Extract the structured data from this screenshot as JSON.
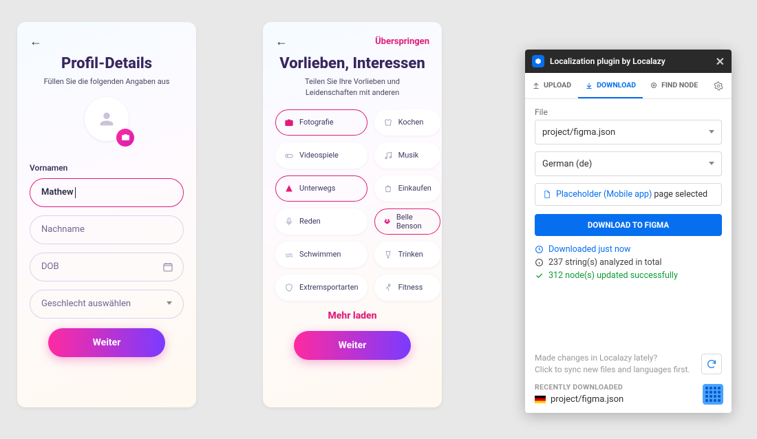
{
  "phone1": {
    "title": "Profil-Details",
    "subtitle": "Füllen Sie die folgenden Angaben aus",
    "firstNameLabel": "Vornamen",
    "firstNameValue": "Mathew",
    "lastNamePlaceholder": "Nachname",
    "dobPlaceholder": "DOB",
    "genderPlaceholder": "Geschlecht auswählen",
    "cta": "Weiter"
  },
  "phone2": {
    "skip": "Überspringen",
    "title": "Vorlieben, Interessen",
    "subtitle": "Teilen Sie Ihre Vorlieben und Leidenschaften mit anderen",
    "chips": [
      {
        "label": "Fotografie",
        "selected": true,
        "icon": "camera"
      },
      {
        "label": "Kochen",
        "selected": false,
        "icon": "chef"
      },
      {
        "label": "Videospiele",
        "selected": false,
        "icon": "gamepad"
      },
      {
        "label": "Musik",
        "selected": false,
        "icon": "music"
      },
      {
        "label": "Unterwegs",
        "selected": true,
        "icon": "route"
      },
      {
        "label": "Einkaufen",
        "selected": false,
        "icon": "bag"
      },
      {
        "label": "Reden",
        "selected": false,
        "icon": "mic"
      },
      {
        "label": "Belle Benson",
        "selected": true,
        "icon": "paw"
      },
      {
        "label": "Schwimmen",
        "selected": false,
        "icon": "waves"
      },
      {
        "label": "Trinken",
        "selected": false,
        "icon": "glass"
      },
      {
        "label": "Extremsportarten",
        "selected": false,
        "icon": "shield"
      },
      {
        "label": "Fitness",
        "selected": false,
        "icon": "run"
      }
    ],
    "more": "Mehr laden",
    "cta": "Weiter"
  },
  "plugin": {
    "headerTitle": "Localization plugin by Localazy",
    "tabs": {
      "upload": "UPLOAD",
      "download": "DOWNLOAD",
      "findNode": "FIND NODE"
    },
    "fileLabel": "File",
    "fileValue": "project/figma.json",
    "langValue": "German (de)",
    "selectedNodeLink": "Placeholder (Mobile app)",
    "selectedNodeSuffix": " page selected",
    "downloadBtn": "DOWNLOAD TO FIGMA",
    "status1": "Downloaded just now",
    "status2": "237 string(s) analyzed in total",
    "status3": "312 node(s) updated successfully",
    "footerLine1": "Made changes in Localazy lately?",
    "footerLine2": "Click to sync new files and languages first.",
    "recentHeader": "RECENTLY DOWNLOADED",
    "recentFile": "project/figma.json"
  }
}
